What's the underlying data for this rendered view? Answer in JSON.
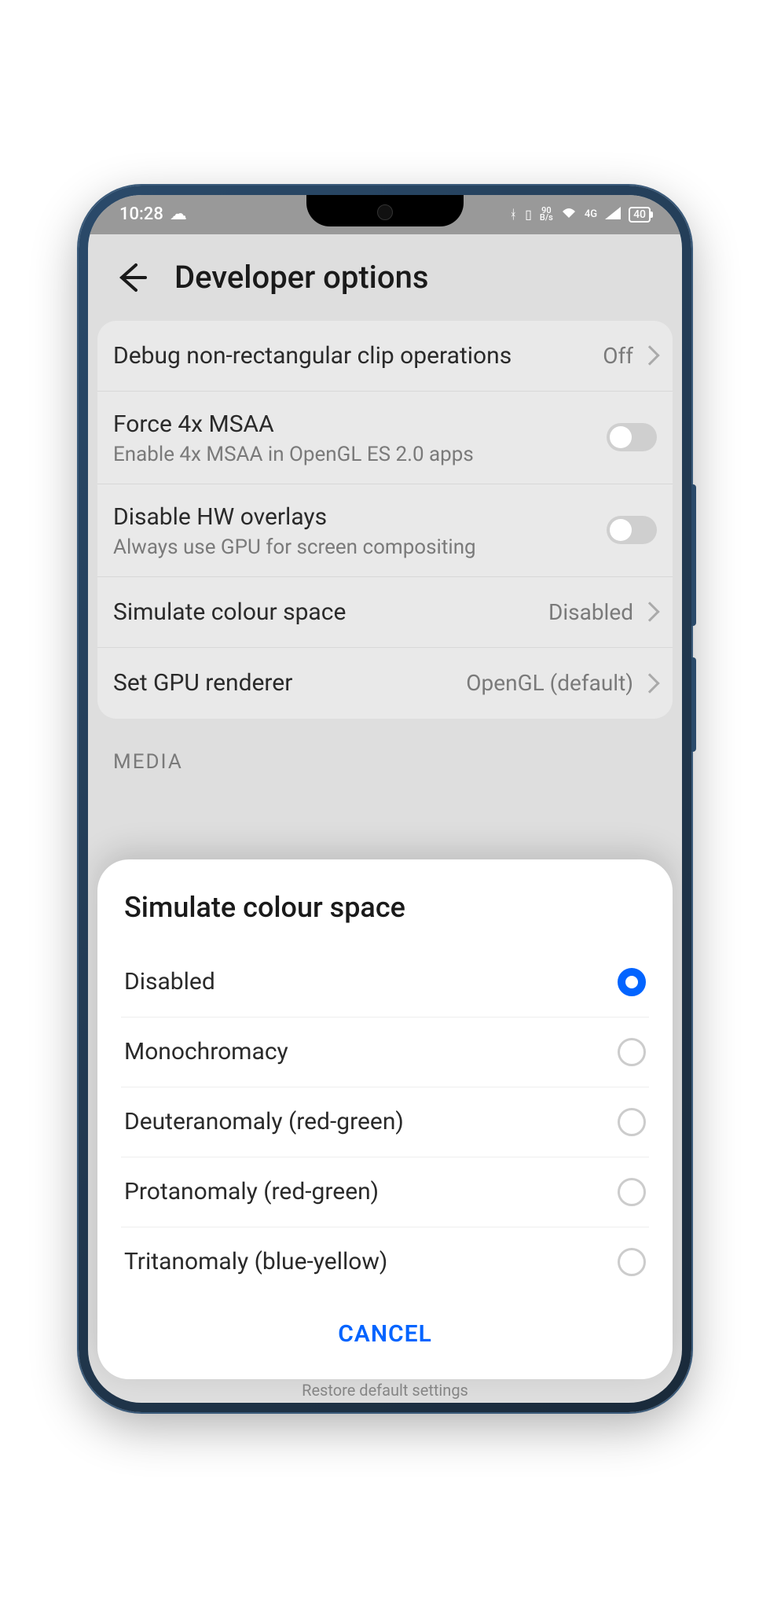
{
  "status": {
    "time": "10:28",
    "bs_top": "90",
    "bs_bot": "B/s",
    "net": "4G",
    "battery": "40"
  },
  "header": {
    "title": "Developer options"
  },
  "rows": {
    "debug_clip": {
      "title": "Debug non-rectangular clip operations",
      "value": "Off"
    },
    "msaa": {
      "title": "Force 4x MSAA",
      "sub": "Enable 4x MSAA in OpenGL ES 2.0 apps"
    },
    "hw_overlays": {
      "title": "Disable HW overlays",
      "sub": "Always use GPU for screen compositing"
    },
    "sim_colour": {
      "title": "Simulate colour space",
      "value": "Disabled"
    },
    "gpu_renderer": {
      "title": "Set GPU renderer",
      "value": "OpenGL (default)"
    }
  },
  "section": {
    "media": "MEDIA"
  },
  "sheet": {
    "title": "Simulate colour space",
    "options": [
      {
        "label": "Disabled",
        "selected": true
      },
      {
        "label": "Monochromacy",
        "selected": false
      },
      {
        "label": "Deuteranomaly (red-green)",
        "selected": false
      },
      {
        "label": "Protanomaly (red-green)",
        "selected": false
      },
      {
        "label": "Tritanomaly (blue-yellow)",
        "selected": false
      }
    ],
    "cancel": "CANCEL"
  },
  "bottom_hint": "Restore default settings"
}
